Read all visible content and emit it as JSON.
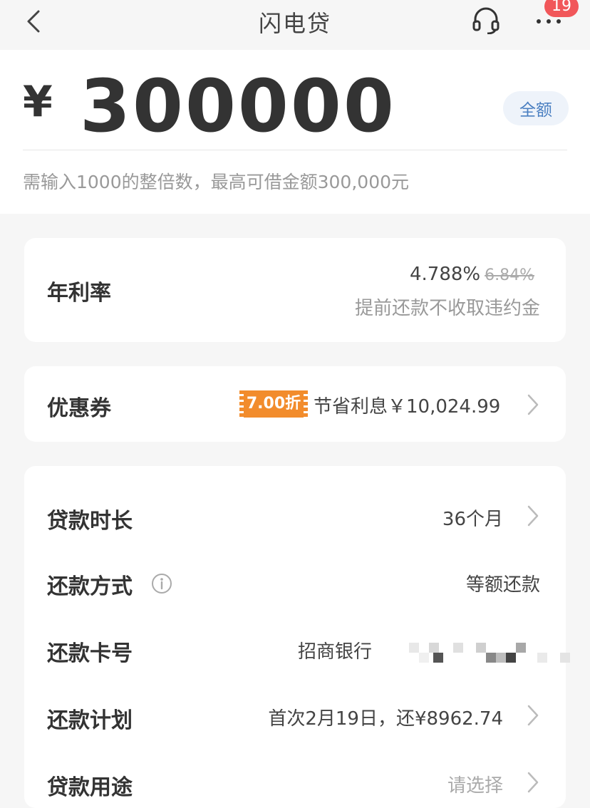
{
  "nav": {
    "title": "闪电贷",
    "badge_count": "19",
    "icons": {
      "back": "chevron-left-icon",
      "service": "headset-icon",
      "more": "more-dots-icon"
    }
  },
  "amount": {
    "currency": "¥",
    "value": "300000",
    "full_button_label": "全额",
    "hint": "需输入1000的整倍数，最高可借金额300,000元"
  },
  "rate": {
    "label": "年利率",
    "current": "4.788%",
    "original": "6.84%",
    "note": "提前还款不收取违约金"
  },
  "coupon": {
    "label": "优惠券",
    "tag": "7.00折",
    "saving": "节省利息￥10,024.99"
  },
  "loan": {
    "duration_label": "贷款时长",
    "duration_value": "36个月",
    "method_label": "还款方式",
    "method_value": "等额还款",
    "card_label": "还款卡号",
    "card_bank": "招商银行",
    "plan_label": "还款计划",
    "plan_value": "首次2月19日，还¥8962.74",
    "purpose_label": "贷款用途",
    "purpose_value": "请选择"
  },
  "colors": {
    "accent_blue": "#4a7fc1",
    "coupon_orange": "#f28c2c",
    "badge_red": "#f1575a"
  }
}
